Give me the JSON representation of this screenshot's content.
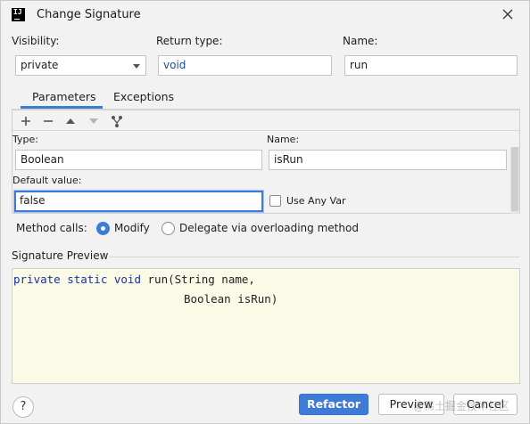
{
  "window": {
    "title": "Change Signature",
    "app_icon_text": "IJ"
  },
  "header": {
    "visibility_label": "Visibility:",
    "visibility_value": "private",
    "return_type_label": "Return type:",
    "return_type_value": "void",
    "name_label": "Name:",
    "name_value": "run"
  },
  "tabs": [
    {
      "label": "Parameters",
      "selected": true
    },
    {
      "label": "Exceptions",
      "selected": false
    }
  ],
  "toolbar": {
    "icons": [
      "add-icon",
      "remove-icon",
      "move-up-icon",
      "move-down-icon",
      "propagate-icon"
    ]
  },
  "parameter": {
    "type_label": "Type:",
    "type_value": "Boolean",
    "name_label": "Name:",
    "name_value": "isRun",
    "default_label": "Default value:",
    "default_value": "false",
    "use_any_var_label": "Use Any Var",
    "use_any_var_checked": false
  },
  "method_calls": {
    "label": "Method calls:",
    "options": [
      {
        "label": "Modify",
        "selected": true
      },
      {
        "label": "Delegate via overloading method",
        "selected": false
      }
    ]
  },
  "signature_preview": {
    "title": "Signature Preview",
    "line1_kw": "private static void",
    "line1_rest": " run(String name,",
    "line2": "Boolean isRun)"
  },
  "buttons": {
    "help": "?",
    "refactor": "Refactor",
    "preview": "Preview",
    "cancel": "Cancel"
  },
  "watermark": "@稀土掘金技术社区",
  "colors": {
    "accent": "#3d7bd6",
    "preview_bg": "#fbfae7",
    "keyword": "#1a2fa8"
  }
}
